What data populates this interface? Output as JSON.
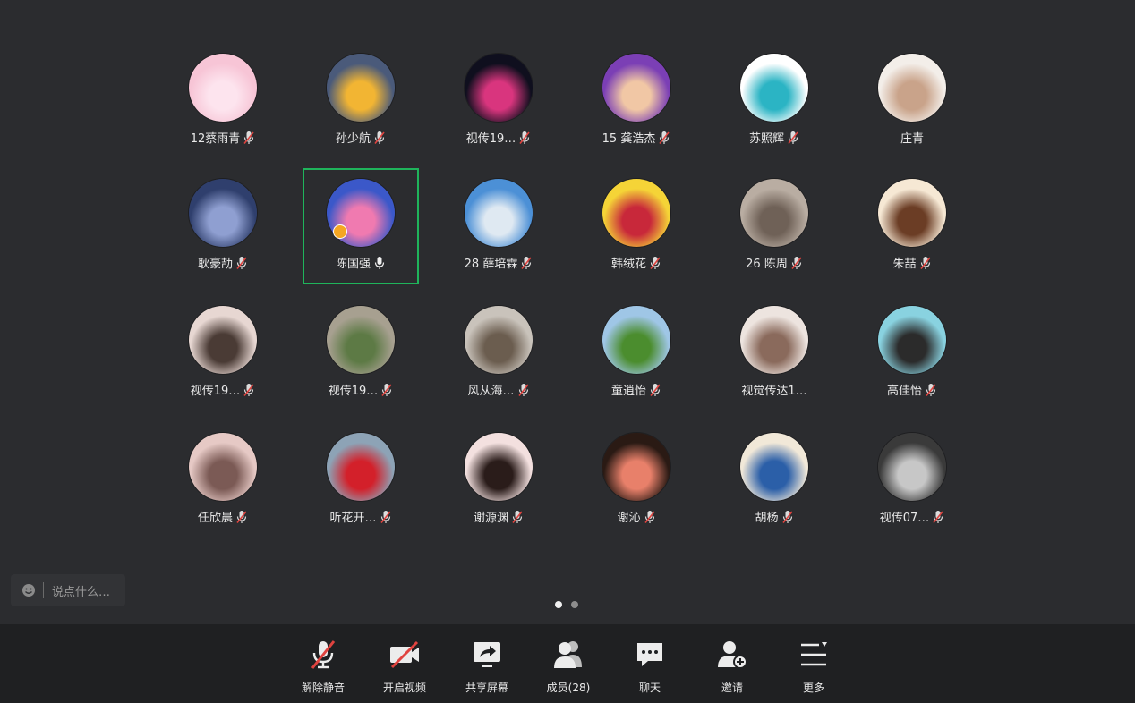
{
  "participants": [
    {
      "name": "12蔡雨青",
      "mic": "muted",
      "avatar_colors": [
        "#f7c5d6",
        "#fde4ee"
      ]
    },
    {
      "name": "孙少航",
      "mic": "muted",
      "avatar_colors": [
        "#4a5a7a",
        "#f2b533"
      ]
    },
    {
      "name": "视传19…",
      "mic": "muted",
      "avatar_colors": [
        "#0f0f1e",
        "#d9357e"
      ]
    },
    {
      "name": "15 龚浩杰",
      "mic": "muted",
      "avatar_colors": [
        "#7b3fb5",
        "#f1c7a5"
      ]
    },
    {
      "name": "苏照辉",
      "mic": "muted",
      "avatar_colors": [
        "#ffffff",
        "#2bb4c4"
      ]
    },
    {
      "name": "庄青",
      "mic": "none",
      "avatar_colors": [
        "#f3eee9",
        "#c9a38a"
      ]
    },
    {
      "name": "耿豪劼",
      "mic": "muted",
      "avatar_colors": [
        "#2f3f6d",
        "#8f9fd1"
      ]
    },
    {
      "name": "陈国强",
      "mic": "active",
      "host": true,
      "speaking": true,
      "avatar_colors": [
        "#3b58c9",
        "#f07ab0"
      ]
    },
    {
      "name": "28 薛培霖",
      "mic": "muted",
      "avatar_colors": [
        "#4c90d6",
        "#dfe9f2"
      ]
    },
    {
      "name": "韩绒花",
      "mic": "muted",
      "avatar_colors": [
        "#f5d437",
        "#c8283a"
      ]
    },
    {
      "name": "26 陈周",
      "mic": "muted",
      "avatar_colors": [
        "#b9ada2",
        "#6f6157"
      ]
    },
    {
      "name": "朱喆",
      "mic": "muted",
      "avatar_colors": [
        "#f6e8d4",
        "#6b3d25"
      ]
    },
    {
      "name": "视传19…",
      "mic": "muted",
      "avatar_colors": [
        "#e7d7d2",
        "#4a3b35"
      ]
    },
    {
      "name": "视传19…",
      "mic": "muted",
      "avatar_colors": [
        "#a7a090",
        "#5d7a45"
      ]
    },
    {
      "name": "风从海…",
      "mic": "muted",
      "avatar_colors": [
        "#c9c3bb",
        "#6b5d4f"
      ]
    },
    {
      "name": "童逍怡",
      "mic": "muted",
      "avatar_colors": [
        "#9fc6e6",
        "#4b8d2e"
      ]
    },
    {
      "name": "视觉传达1…",
      "mic": "none",
      "avatar_colors": [
        "#ede4df",
        "#8a6a5c"
      ]
    },
    {
      "name": "高佳怡",
      "mic": "muted",
      "avatar_colors": [
        "#89d2e0",
        "#2b2b2b"
      ]
    },
    {
      "name": "任欣晨",
      "mic": "muted",
      "avatar_colors": [
        "#e6c9c5",
        "#7b5a55"
      ]
    },
    {
      "name": "听花开…",
      "mic": "muted",
      "avatar_colors": [
        "#8da3b6",
        "#d3202a"
      ]
    },
    {
      "name": "谢源渊",
      "mic": "muted",
      "avatar_colors": [
        "#f3e0df",
        "#2a1c1a"
      ]
    },
    {
      "name": "谢沁",
      "mic": "muted",
      "avatar_colors": [
        "#2a1a14",
        "#e8806a"
      ]
    },
    {
      "name": "胡杨",
      "mic": "muted",
      "avatar_colors": [
        "#f1e8d8",
        "#2b5fa8"
      ]
    },
    {
      "name": "视传07…",
      "mic": "muted",
      "avatar_colors": [
        "#3a3a3a",
        "#c7c7c7"
      ]
    }
  ],
  "comment": {
    "placeholder": "说点什么…"
  },
  "pagination": {
    "pages": 2,
    "current": 1
  },
  "toolbar": {
    "unmute": "解除静音",
    "video": "开启视频",
    "share": "共享屏幕",
    "members": "成员(28)",
    "chat": "聊天",
    "invite": "邀请",
    "more": "更多"
  },
  "colors": {
    "background": "#2b2c2f",
    "toolbar": "#1f2022",
    "speaking_border": "#1fb45b",
    "mute_slash": "#e0433f"
  }
}
